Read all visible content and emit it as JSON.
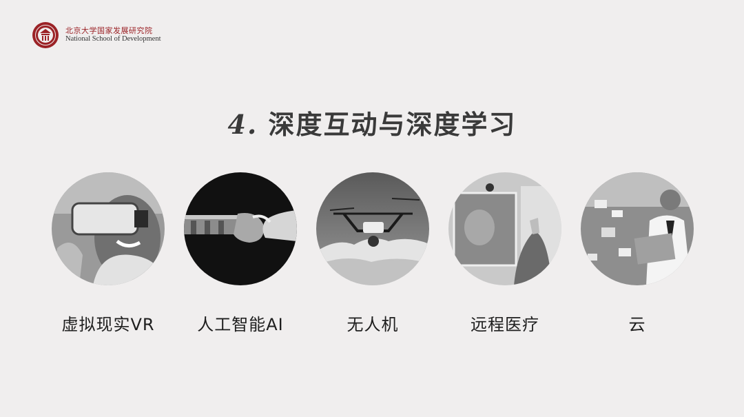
{
  "header": {
    "org_name_cn": "北京大学国家发展研究院",
    "org_name_en": "National School of Development"
  },
  "title": {
    "number": "4.",
    "text": "深度互动与深度学习"
  },
  "items": [
    {
      "label": "虚拟现实VR",
      "icon": "vr-headset-photo"
    },
    {
      "label": "人工智能AI",
      "icon": "robot-handshake-photo"
    },
    {
      "label": "无人机",
      "icon": "drone-photo"
    },
    {
      "label": "远程医疗",
      "icon": "telemedicine-photo"
    },
    {
      "label": "云",
      "icon": "cloud-computing-photo"
    }
  ],
  "colors": {
    "background": "#f0eeee",
    "brand_red": "#9b2226",
    "text": "#1e1e1e"
  }
}
